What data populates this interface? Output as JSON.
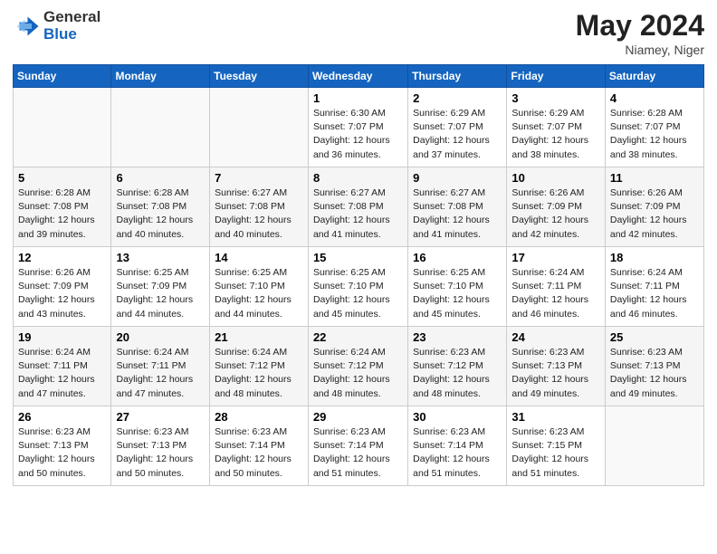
{
  "header": {
    "logo_general": "General",
    "logo_blue": "Blue",
    "month_title": "May 2024",
    "location": "Niamey, Niger"
  },
  "days_of_week": [
    "Sunday",
    "Monday",
    "Tuesday",
    "Wednesday",
    "Thursday",
    "Friday",
    "Saturday"
  ],
  "weeks": [
    [
      {
        "num": "",
        "info": ""
      },
      {
        "num": "",
        "info": ""
      },
      {
        "num": "",
        "info": ""
      },
      {
        "num": "1",
        "info": "Sunrise: 6:30 AM\nSunset: 7:07 PM\nDaylight: 12 hours\nand 36 minutes."
      },
      {
        "num": "2",
        "info": "Sunrise: 6:29 AM\nSunset: 7:07 PM\nDaylight: 12 hours\nand 37 minutes."
      },
      {
        "num": "3",
        "info": "Sunrise: 6:29 AM\nSunset: 7:07 PM\nDaylight: 12 hours\nand 38 minutes."
      },
      {
        "num": "4",
        "info": "Sunrise: 6:28 AM\nSunset: 7:07 PM\nDaylight: 12 hours\nand 38 minutes."
      }
    ],
    [
      {
        "num": "5",
        "info": "Sunrise: 6:28 AM\nSunset: 7:08 PM\nDaylight: 12 hours\nand 39 minutes."
      },
      {
        "num": "6",
        "info": "Sunrise: 6:28 AM\nSunset: 7:08 PM\nDaylight: 12 hours\nand 40 minutes."
      },
      {
        "num": "7",
        "info": "Sunrise: 6:27 AM\nSunset: 7:08 PM\nDaylight: 12 hours\nand 40 minutes."
      },
      {
        "num": "8",
        "info": "Sunrise: 6:27 AM\nSunset: 7:08 PM\nDaylight: 12 hours\nand 41 minutes."
      },
      {
        "num": "9",
        "info": "Sunrise: 6:27 AM\nSunset: 7:08 PM\nDaylight: 12 hours\nand 41 minutes."
      },
      {
        "num": "10",
        "info": "Sunrise: 6:26 AM\nSunset: 7:09 PM\nDaylight: 12 hours\nand 42 minutes."
      },
      {
        "num": "11",
        "info": "Sunrise: 6:26 AM\nSunset: 7:09 PM\nDaylight: 12 hours\nand 42 minutes."
      }
    ],
    [
      {
        "num": "12",
        "info": "Sunrise: 6:26 AM\nSunset: 7:09 PM\nDaylight: 12 hours\nand 43 minutes."
      },
      {
        "num": "13",
        "info": "Sunrise: 6:25 AM\nSunset: 7:09 PM\nDaylight: 12 hours\nand 44 minutes."
      },
      {
        "num": "14",
        "info": "Sunrise: 6:25 AM\nSunset: 7:10 PM\nDaylight: 12 hours\nand 44 minutes."
      },
      {
        "num": "15",
        "info": "Sunrise: 6:25 AM\nSunset: 7:10 PM\nDaylight: 12 hours\nand 45 minutes."
      },
      {
        "num": "16",
        "info": "Sunrise: 6:25 AM\nSunset: 7:10 PM\nDaylight: 12 hours\nand 45 minutes."
      },
      {
        "num": "17",
        "info": "Sunrise: 6:24 AM\nSunset: 7:11 PM\nDaylight: 12 hours\nand 46 minutes."
      },
      {
        "num": "18",
        "info": "Sunrise: 6:24 AM\nSunset: 7:11 PM\nDaylight: 12 hours\nand 46 minutes."
      }
    ],
    [
      {
        "num": "19",
        "info": "Sunrise: 6:24 AM\nSunset: 7:11 PM\nDaylight: 12 hours\nand 47 minutes."
      },
      {
        "num": "20",
        "info": "Sunrise: 6:24 AM\nSunset: 7:11 PM\nDaylight: 12 hours\nand 47 minutes."
      },
      {
        "num": "21",
        "info": "Sunrise: 6:24 AM\nSunset: 7:12 PM\nDaylight: 12 hours\nand 48 minutes."
      },
      {
        "num": "22",
        "info": "Sunrise: 6:24 AM\nSunset: 7:12 PM\nDaylight: 12 hours\nand 48 minutes."
      },
      {
        "num": "23",
        "info": "Sunrise: 6:23 AM\nSunset: 7:12 PM\nDaylight: 12 hours\nand 48 minutes."
      },
      {
        "num": "24",
        "info": "Sunrise: 6:23 AM\nSunset: 7:13 PM\nDaylight: 12 hours\nand 49 minutes."
      },
      {
        "num": "25",
        "info": "Sunrise: 6:23 AM\nSunset: 7:13 PM\nDaylight: 12 hours\nand 49 minutes."
      }
    ],
    [
      {
        "num": "26",
        "info": "Sunrise: 6:23 AM\nSunset: 7:13 PM\nDaylight: 12 hours\nand 50 minutes."
      },
      {
        "num": "27",
        "info": "Sunrise: 6:23 AM\nSunset: 7:13 PM\nDaylight: 12 hours\nand 50 minutes."
      },
      {
        "num": "28",
        "info": "Sunrise: 6:23 AM\nSunset: 7:14 PM\nDaylight: 12 hours\nand 50 minutes."
      },
      {
        "num": "29",
        "info": "Sunrise: 6:23 AM\nSunset: 7:14 PM\nDaylight: 12 hours\nand 51 minutes."
      },
      {
        "num": "30",
        "info": "Sunrise: 6:23 AM\nSunset: 7:14 PM\nDaylight: 12 hours\nand 51 minutes."
      },
      {
        "num": "31",
        "info": "Sunrise: 6:23 AM\nSunset: 7:15 PM\nDaylight: 12 hours\nand 51 minutes."
      },
      {
        "num": "",
        "info": ""
      }
    ]
  ]
}
